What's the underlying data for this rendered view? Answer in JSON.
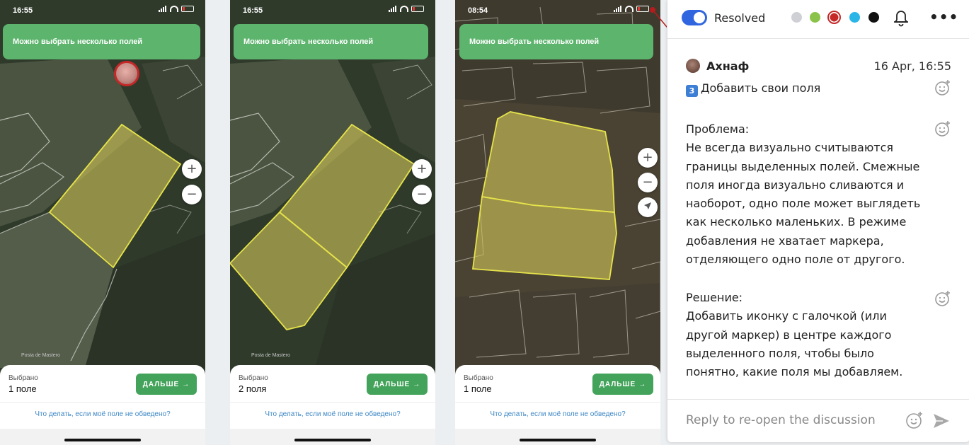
{
  "phones": [
    {
      "status_time": "16:55",
      "banner": "Можно выбрать несколько полей",
      "zoom_in": "+",
      "zoom_out": "−",
      "selected_label": "Выбрано",
      "selected_count": "1 поле",
      "next_label": "ДАЛЬШЕ",
      "next_arrow": "→",
      "help_link": "Что делать, если моё поле не обведено?"
    },
    {
      "status_time": "16:55",
      "banner": "Можно выбрать несколько полей",
      "zoom_in": "+",
      "zoom_out": "−",
      "selected_label": "Выбрано",
      "selected_count": "2 поля",
      "next_label": "ДАЛЬШЕ",
      "next_arrow": "→",
      "help_link": "Что делать, если моё поле не обведено?"
    },
    {
      "status_time": "08:54",
      "banner": "Можно выбрать несколько полей",
      "zoom_in": "+",
      "zoom_out": "−",
      "nav_icon": "location-arrow-icon",
      "selected_label": "Выбрано",
      "selected_count": "1 поле",
      "next_label": "ДАЛЬШЕ",
      "next_arrow": "→",
      "help_link": "Что делать, если моё поле не обведено?"
    }
  ],
  "panel": {
    "toggle_on": true,
    "resolved_label": "Resolved",
    "color_dots": [
      "#cfcfd6",
      "#8bc34a",
      "#c62828",
      "#29b6e6",
      "#111111"
    ],
    "author": "Ахнаф",
    "date": "16 Apr, 16:55",
    "title_key": "3",
    "title": "Добавить свои поля",
    "problem": "Проблема:\nНе всегда визуально считываются\nграницы выделенных полей. Смежные\nполя иногда визуально сливаются и\nнаоборот, одно поле может выглядеть\nкак несколько маленьких. В режиме\nдобавления не хватает маркера,\nотделяющего одно поле от другого.",
    "solution": "Решение:\nДобавить иконку с галочкой (или\nдругой маркер) в центре каждого\nвыделенного поля, чтобы было\nпонятно, какие поля мы добавляем.",
    "reply_placeholder": "Reply to re-open the discussion"
  }
}
